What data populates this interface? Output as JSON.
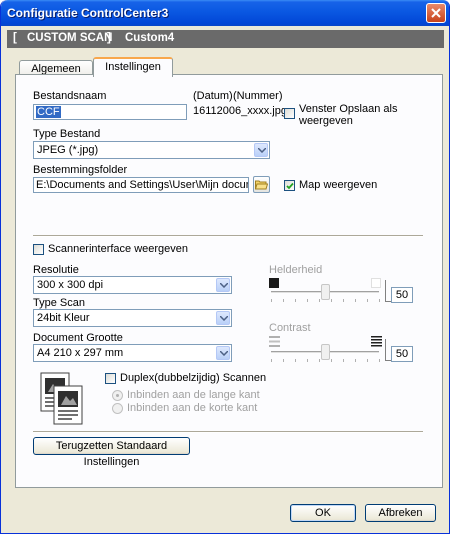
{
  "window": {
    "title": "Configuratie ControlCenter3"
  },
  "header": {
    "bracket_open": "[",
    "mode": "CUSTOM SCAN",
    "bracket_close": "]",
    "name": "Custom4"
  },
  "tabs": [
    {
      "label": "Algemeen",
      "active": false
    },
    {
      "label": "Instellingen",
      "active": true
    }
  ],
  "file": {
    "name_label": "Bestandsnaam",
    "name_value": "CCF",
    "date_label": "(Datum)",
    "number_label": "(Nummer)",
    "file_suffix": "16112006_xxxx.jpg",
    "save_window_label_1": "Venster Opslaan als",
    "save_window_label_2": "weergeven",
    "save_window_checked": false,
    "type_label": "Type Bestand",
    "type_value": "JPEG (*.jpg)",
    "folder_label": "Bestemmingsfolder",
    "folder_value": "E:\\Documents and Settings\\User\\Mijn documenten\\M",
    "show_folder_label": "Map weergeven",
    "show_folder_checked": true
  },
  "scanner": {
    "interface_label": "Scannerinterface weergeven",
    "interface_checked": false,
    "resolution_label": "Resolutie",
    "resolution_value": "300 x 300 dpi",
    "scan_type_label": "Type Scan",
    "scan_type_value": "24bit Kleur",
    "doc_size_label": "Document Grootte",
    "doc_size_value": "A4 210 x 297 mm",
    "brightness_label": "Helderheid",
    "brightness_value": "50",
    "contrast_label": "Contrast",
    "contrast_value": "50",
    "duplex_label": "Duplex(dubbelzijdig) Scannen",
    "duplex_checked": false,
    "binding_long": "Inbinden aan de lange kant",
    "binding_short": "Inbinden aan de korte kant"
  },
  "buttons": {
    "reset": "Terugzetten Standaard Instellingen",
    "ok": "OK",
    "cancel": "Afbreken"
  }
}
